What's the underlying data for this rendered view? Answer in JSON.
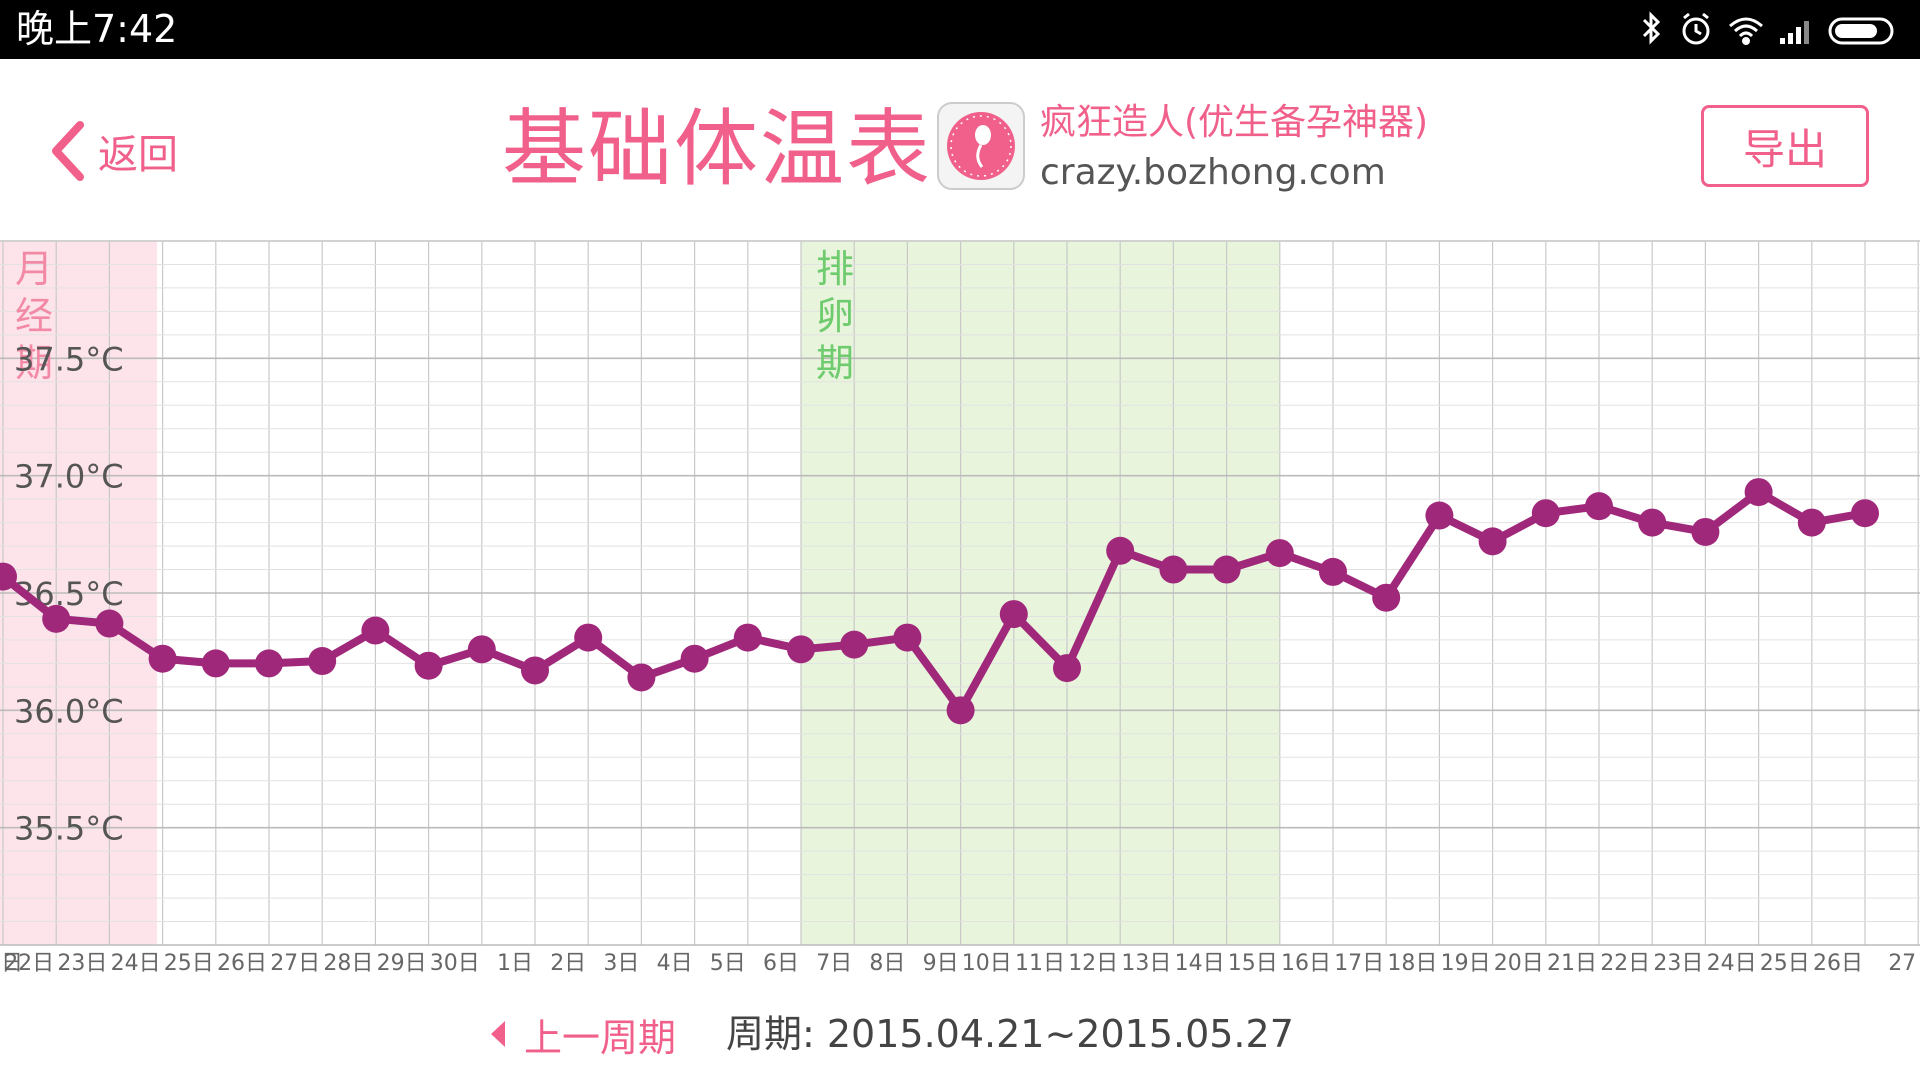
{
  "status_bar": {
    "time": "晚上7:42",
    "icons": [
      "bluetooth-icon",
      "alarm-icon",
      "wifi-icon",
      "signal-icon",
      "battery-icon"
    ]
  },
  "header": {
    "back_label": "返回",
    "title": "基础体温表",
    "app_name": "疯狂造人(优生备孕神器)",
    "app_url": "crazy.bozhong.com",
    "export_label": "导出"
  },
  "colors": {
    "accent": "#f0608a",
    "line": "#a0287a",
    "menses_band": "#fde4ea",
    "ovulation_band": "#e8f4dc",
    "ovulation_text": "#6ecb6e",
    "menses_text": "#f28aa6"
  },
  "chart_data": {
    "type": "line",
    "x_labels": [
      "日",
      "22日",
      "23日",
      "24日",
      "25日",
      "26日",
      "27日",
      "28日",
      "29日",
      "30日",
      "1日",
      "2日",
      "3日",
      "4日",
      "5日",
      "6日",
      "7日",
      "8日",
      "9日",
      "10日",
      "11日",
      "12日",
      "13日",
      "14日",
      "15日",
      "16日",
      "17日",
      "18日",
      "19日",
      "20日",
      "21日",
      "22日",
      "23日",
      "24日",
      "25日",
      "26日",
      "27"
    ],
    "y_ticks": [
      {
        "value": 37.5,
        "label": "37.5°C"
      },
      {
        "value": 37.0,
        "label": "37.0°C"
      },
      {
        "value": 36.5,
        "label": "36.5°C"
      },
      {
        "value": 36.0,
        "label": "36.0°C"
      },
      {
        "value": 35.5,
        "label": "35.5°C"
      }
    ],
    "ylim": [
      35.0,
      38.0
    ],
    "series": [
      {
        "values": [
          36.57,
          36.39,
          36.37,
          36.22,
          36.2,
          36.2,
          36.21,
          36.34,
          36.19,
          36.26,
          36.17,
          36.31,
          36.14,
          36.22,
          36.31,
          36.26,
          36.28,
          36.31,
          36.0,
          36.41,
          36.18,
          36.68,
          36.6,
          36.6,
          36.67,
          36.59,
          36.48,
          36.83,
          36.72,
          36.84,
          36.87,
          36.8,
          36.76,
          36.93,
          36.8,
          36.84
        ]
      }
    ],
    "bands": [
      {
        "label": "月经期",
        "start_index": 0,
        "end_index": 3
      },
      {
        "label": "排卵期",
        "start_index": 16,
        "end_index": 25
      }
    ],
    "grid": true
  },
  "footer": {
    "prev_cycle_label": "上一周期",
    "cycle_text": "周期: 2015.04.21~2015.05.27"
  }
}
